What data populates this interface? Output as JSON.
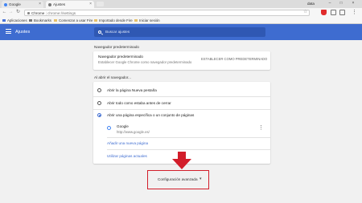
{
  "browser": {
    "tabs": [
      {
        "label": "Google",
        "color": "#4285f4"
      },
      {
        "label": "Ajustes",
        "color": "#777777"
      }
    ],
    "user": "data",
    "address": {
      "prefix": "Chrome",
      "url": "chrome://settings"
    },
    "bookmarks": [
      "Aplicaciones",
      "Bookmarks",
      "Comenzar a usar Fire",
      "Importado desde Fire",
      "Iniciar sesión"
    ]
  },
  "app": {
    "title": "Ajustes",
    "search_placeholder": "Buscar ajustes",
    "accent": "#3e6cd0"
  },
  "default_browser": {
    "section_title": "Navegador predeterminado",
    "label": "Navegador predeterminado",
    "description": "Establecer Google Chrome como navegador predeterminado",
    "action": "ESTABLECER COMO PREDETERMINADO"
  },
  "startup": {
    "section_title": "Al abrir el navegador...",
    "options": [
      {
        "label": "Abrir la página Nueva pestaña",
        "selected": false
      },
      {
        "label": "Abrir todo como estaba antes de cerrar",
        "selected": false
      },
      {
        "label": "Abrir una página específica o un conjunto de páginas",
        "selected": true
      }
    ],
    "page": {
      "name": "Google",
      "url": "http://www.google.es/"
    },
    "add_page": "Añadir una nueva página",
    "use_current": "Utilizar páginas actuales"
  },
  "advanced": {
    "label": "Configuración avanzada",
    "highlight_color": "#d21d2a"
  }
}
